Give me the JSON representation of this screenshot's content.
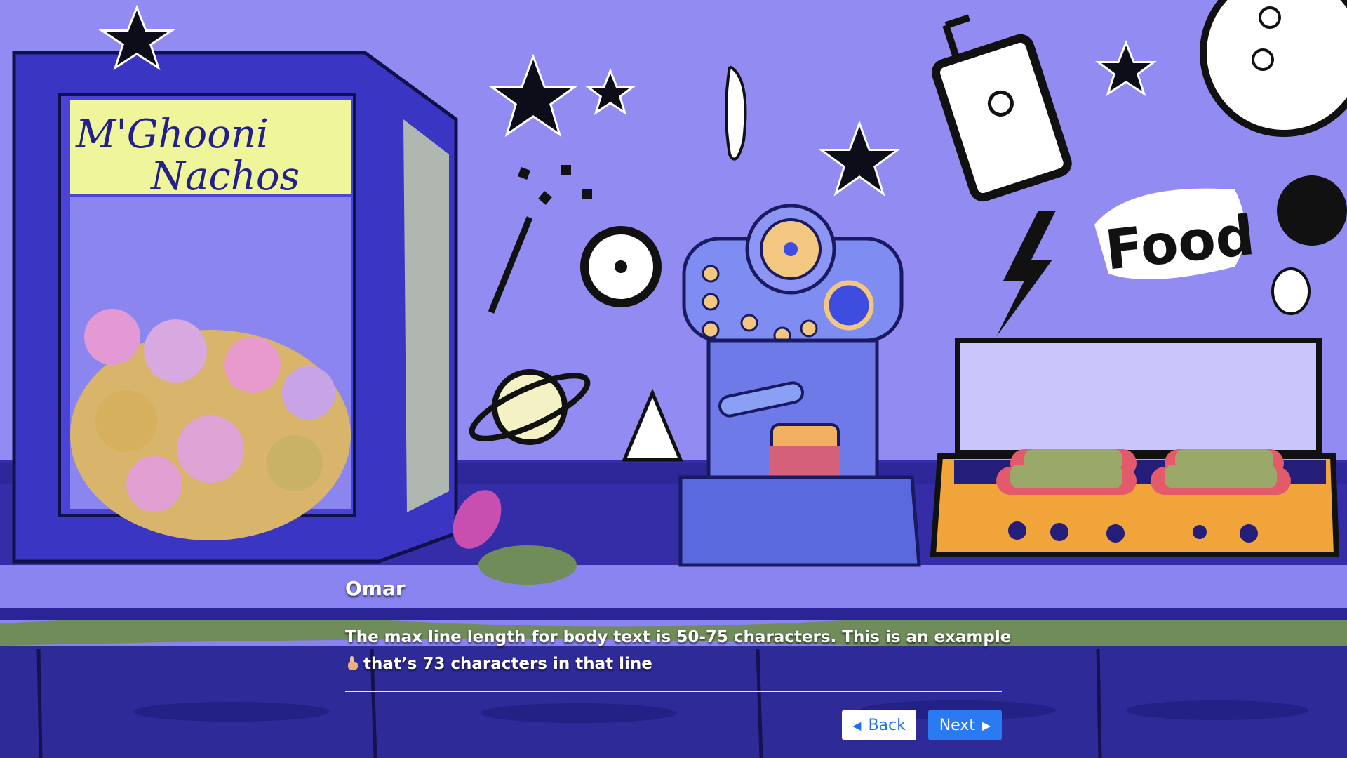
{
  "scene": {
    "machine_sign_line1": "M'Ghooni",
    "machine_sign_line2": "Nachos",
    "food_sign": "Food"
  },
  "dialogue": {
    "speaker": "Omar",
    "line1": "The max line length for body text is 50-75 characters. This is an example",
    "line2": "that’s 73 characters in that line"
  },
  "nav": {
    "back_label": "Back",
    "next_label": "Next",
    "back_icon": "triangle-left-icon",
    "next_icon": "triangle-right-icon"
  },
  "colors": {
    "wall": "#8a84f0",
    "counter": "#2f2a9e",
    "next_button": "#2a7bf2",
    "back_button_text": "#1e6ff0"
  }
}
